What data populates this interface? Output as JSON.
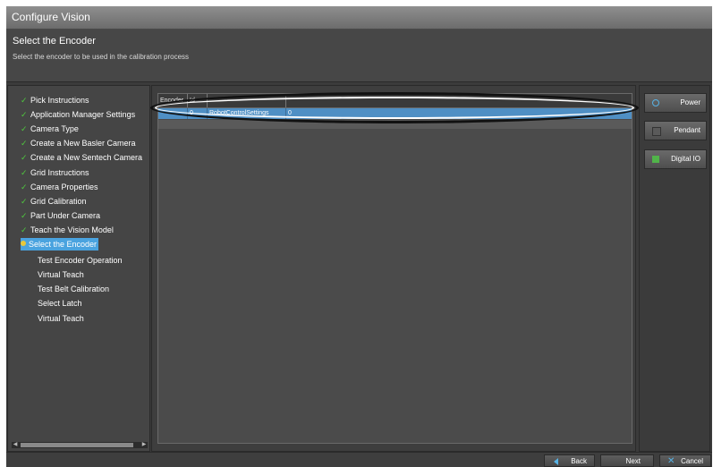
{
  "window": {
    "title": "Configure Vision"
  },
  "header": {
    "title": "Select the Encoder",
    "subtitle": "Select the encoder to be used in the calibration process"
  },
  "steps": [
    {
      "label": "Pick Instructions",
      "status": "done"
    },
    {
      "label": "Application Manager Settings",
      "status": "done"
    },
    {
      "label": "Camera Type",
      "status": "done"
    },
    {
      "label": "Create a New Basler Camera",
      "status": "done"
    },
    {
      "label": "Create a New Sentech Camera",
      "status": "done"
    },
    {
      "label": "Grid Instructions",
      "status": "done"
    },
    {
      "label": "Camera Properties",
      "status": "done"
    },
    {
      "label": "Grid Calibration",
      "status": "done"
    },
    {
      "label": "Part Under Camera",
      "status": "done"
    },
    {
      "label": "Teach the Vision Model",
      "status": "done"
    },
    {
      "label": "Select the Encoder",
      "status": "current"
    },
    {
      "label": "Test Encoder Operation",
      "status": "pending"
    },
    {
      "label": "Virtual Teach",
      "status": "pending"
    },
    {
      "label": "Test Belt Calibration",
      "status": "pending"
    },
    {
      "label": "Select Latch",
      "status": "pending"
    },
    {
      "label": "Virtual Teach",
      "status": "pending"
    }
  ],
  "table": {
    "columns": [
      "Encoder",
      "Id",
      "",
      ""
    ],
    "rows": [
      {
        "encoder": "",
        "id": "0",
        "controller": "RobotControlSettings",
        "value": "0"
      }
    ]
  },
  "right_panel": {
    "power": "Power",
    "pendant": "Pendant",
    "digital_io": "Digital IO"
  },
  "footer": {
    "back": "Back",
    "next": "Next",
    "cancel": "Cancel"
  },
  "colors": {
    "check": "#4fc83e",
    "accent": "#4aa3df",
    "selected_row": "#4f8fc4",
    "icon_blue": "#57b3e6",
    "io_green": "#51b44a"
  }
}
